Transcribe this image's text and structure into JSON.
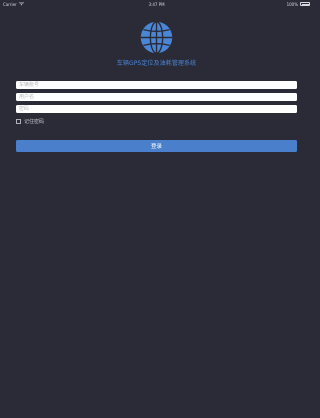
{
  "status_bar": {
    "carrier": "Carrier",
    "time": "3:47 PM",
    "battery": "100%"
  },
  "app": {
    "title": "车辆GPS定位及油耗管理系统",
    "logo_icon": "globe-icon",
    "accent_color": "#4a86d6"
  },
  "form": {
    "plate_placeholder": "车辆账号",
    "user_placeholder": "用户名",
    "pass_placeholder": "密码",
    "remember_label": "记住密码",
    "login_label": "登录"
  }
}
